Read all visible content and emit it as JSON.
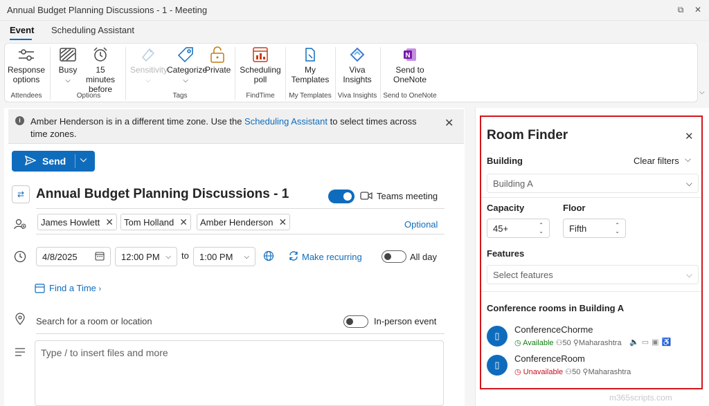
{
  "window": {
    "title": "Annual Budget Planning Discussions - 1 - Meeting"
  },
  "tabs": [
    {
      "label": "Event",
      "active": true
    },
    {
      "label": "Scheduling Assistant",
      "active": false
    }
  ],
  "ribbon": {
    "response_options": "Response options",
    "group_attendees": "Attendees",
    "busy": "Busy",
    "reminder": "15 minutes before",
    "group_options": "Options",
    "sensitivity": "Sensitivity",
    "categorize": "Categorize",
    "private": "Private",
    "group_tags": "Tags",
    "scheduling_poll": "Scheduling poll",
    "group_findtime": "FindTime",
    "my_templates": "My Templates",
    "group_my_templates": "My Templates",
    "viva_insights": "Viva Insights",
    "group_viva": "Viva Insights",
    "send_onenote": "Send to OneNote",
    "group_onenote": "Send to OneNote"
  },
  "infobar": {
    "text_before": "Amber Henderson is in a different time zone. Use the ",
    "link": "Scheduling Assistant",
    "text_after": " to select times across time zones."
  },
  "compose": {
    "send_label": "Send",
    "subject": "Annual Budget Planning Discussions - 1",
    "teams_label": "Teams meeting",
    "attendees": [
      "James Howlett",
      "Tom Holland",
      "Amber Henderson"
    ],
    "optional_label": "Optional",
    "start_date": "4/8/2025",
    "start_time": "12:00 PM",
    "to_label": "to",
    "end_time": "1:00 PM",
    "recurring_label": "Make recurring",
    "allday_label": "All day",
    "find_time_label": "Find a Time",
    "location_placeholder": "Search for a room or location",
    "inperson_label": "In-person event",
    "body_placeholder": "Type / to insert files and more"
  },
  "room_finder": {
    "title": "Room Finder",
    "building_label": "Building",
    "clear_filters": "Clear filters",
    "building_value": "Building A",
    "capacity_label": "Capacity",
    "capacity_value": "45+",
    "floor_label": "Floor",
    "floor_value": "Fifth",
    "features_label": "Features",
    "features_placeholder": "Select features",
    "rooms_heading": "Conference rooms in Building A",
    "rooms": [
      {
        "name": "ConferenceChorme",
        "status": "Available",
        "status_color": "#107c10",
        "capacity": "50",
        "location": "Maharashtra"
      },
      {
        "name": "ConferenceRoom",
        "status": "Unavailable",
        "status_color": "#c50f1f",
        "capacity": "50",
        "location": "Maharashtra"
      }
    ]
  },
  "watermark": "m365scripts.com"
}
